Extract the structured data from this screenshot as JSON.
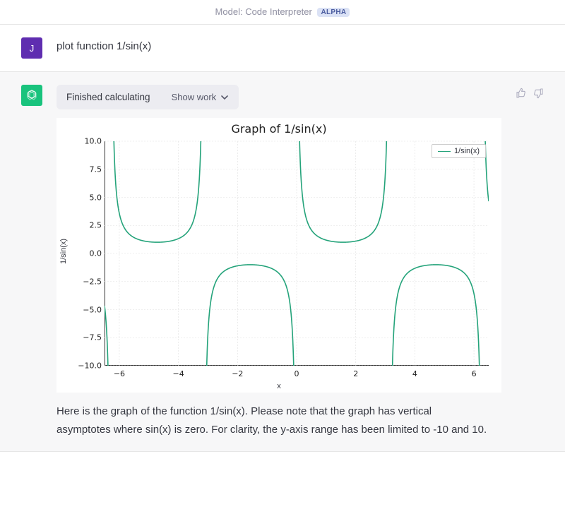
{
  "header": {
    "model_prefix": "Model: ",
    "model_name": "Code Interpreter",
    "badge": "ALPHA"
  },
  "user": {
    "initial": "J",
    "message": "plot function 1/sin(x)"
  },
  "assistant": {
    "status": "Finished calculating",
    "show_work": "Show work",
    "response": "Here is the graph of the function 1/sin(x). Please note that the graph has vertical asymptotes where sin(x) is zero. For clarity, the y-axis range has been limited to -10 and 10."
  },
  "chart_data": {
    "type": "line",
    "title": "Graph of 1/sin(x)",
    "xlabel": "x",
    "ylabel": "1/sin(x)",
    "xlim": [
      -6.5,
      6.5
    ],
    "ylim": [
      -10,
      10
    ],
    "xticks": [
      -6,
      -4,
      -2,
      0,
      2,
      4,
      6
    ],
    "yticks": [
      -10.0,
      -7.5,
      -5.0,
      -2.5,
      0.0,
      2.5,
      5.0,
      7.5,
      10.0
    ],
    "legend": [
      "1/sin(x)"
    ],
    "series": [
      {
        "name": "1/sin(x)",
        "function": "1/sin(x)",
        "color": "#24a37a"
      }
    ],
    "asymptotes_x": [
      -6.2832,
      -3.1416,
      0,
      3.1416,
      6.2832
    ],
    "grid": true
  }
}
